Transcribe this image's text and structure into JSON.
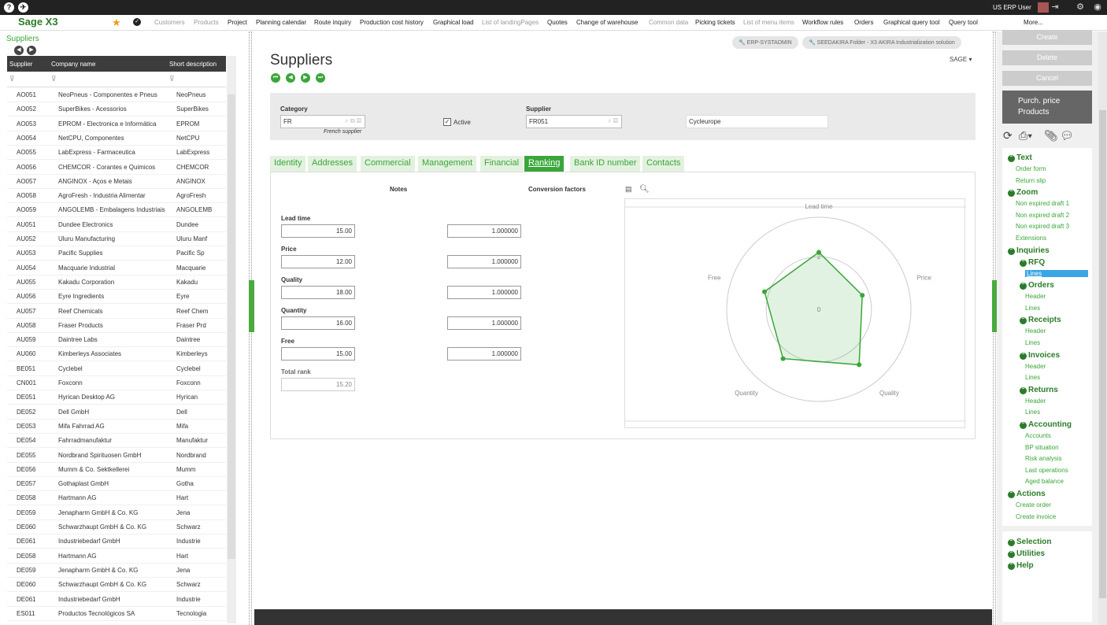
{
  "topbar": {
    "user": "US ERP User"
  },
  "nav": {
    "logo": "Sage X3",
    "items": [
      {
        "label": "Customers",
        "enabled": false
      },
      {
        "label": "Products",
        "enabled": false
      },
      {
        "label": "Project",
        "enabled": true
      },
      {
        "label": "Planning calendar",
        "enabled": true
      },
      {
        "label": "Route inquiry",
        "enabled": true
      },
      {
        "label": "Production cost history",
        "enabled": true
      },
      {
        "label": "Graphical load",
        "enabled": true
      },
      {
        "label": "List of landingPages",
        "enabled": false
      },
      {
        "label": "Quotes",
        "enabled": true
      },
      {
        "label": "Change of warehouse",
        "enabled": true
      },
      {
        "label": "Common data",
        "enabled": false
      },
      {
        "label": "Picking tickets",
        "enabled": true
      },
      {
        "label": "List of menu items",
        "enabled": false
      },
      {
        "label": "Workflow rules",
        "enabled": true
      },
      {
        "label": "Orders",
        "enabled": true
      },
      {
        "label": "Graphical query tool",
        "enabled": true
      },
      {
        "label": "Query tool",
        "enabled": true
      },
      {
        "label": "More...",
        "enabled": true
      }
    ]
  },
  "left": {
    "link": "Suppliers",
    "columns": [
      "Supplier",
      "Company name",
      "Short description"
    ],
    "rows": [
      [
        "AO051",
        "NeoPneus - Componentes e Pneus",
        "NeoPneus"
      ],
      [
        "AO052",
        "SuperBikes - Acessorios",
        "SuperBikes"
      ],
      [
        "AO053",
        "EPROM - Electronica e Informática",
        "EPROM"
      ],
      [
        "AO054",
        "NetCPU, Componentes",
        "NetCPU"
      ],
      [
        "AO055",
        "LabExpress - Farmaceutica",
        "LabExpress"
      ],
      [
        "AO056",
        "CHEMCOR - Corantes e Quimicos",
        "CHEMCOR"
      ],
      [
        "AO057",
        "ANGINOX - Aços e Metais",
        "ANGINOX"
      ],
      [
        "AO058",
        "AgroFresh - Industria Alimentar",
        "AgroFresh"
      ],
      [
        "AO059",
        "ANGOLEMB - Embalagens Industriais",
        "ANGOLEMB"
      ],
      [
        "AU051",
        "Dundee Electronics",
        "Dundee"
      ],
      [
        "AU052",
        "Uluru Manufacturing",
        "Uluru Manf"
      ],
      [
        "AU053",
        "Pacific Supplies",
        "Pacific Sp"
      ],
      [
        "AU054",
        "Macquarie Industrial",
        "Macquarie"
      ],
      [
        "AU055",
        "Kakadu Corporation",
        "Kakadu"
      ],
      [
        "AU056",
        "Eyre Ingredients",
        "Eyre"
      ],
      [
        "AU057",
        "Reef Chemicals",
        "Reef Chem"
      ],
      [
        "AU058",
        "Fraser Products",
        "Fraser Prd"
      ],
      [
        "AU059",
        "Daintree Labs",
        "Daintree"
      ],
      [
        "AU060",
        "Kimberleys Associates",
        "Kimberleys"
      ],
      [
        "BE051",
        "Cyclebel",
        "Cyclebel"
      ],
      [
        "CN001",
        "Foxconn",
        "Foxconn"
      ],
      [
        "DE051",
        "Hyrican Desktop AG",
        "Hyrican"
      ],
      [
        "DE052",
        "Dell GmbH",
        "Dell"
      ],
      [
        "DE053",
        "Mifa Fahrrad AG",
        "Mifa"
      ],
      [
        "DE054",
        "Fahrradmanufaktur",
        "Manufaktur"
      ],
      [
        "DE055",
        "Nordbrand Spirituosen GmbH",
        "Nordbrand"
      ],
      [
        "DE056",
        "Mumm & Co. Sektkellerei",
        "Mumm"
      ],
      [
        "DE057",
        "Gothaplast GmbH",
        "Gotha"
      ],
      [
        "DE058",
        "Hartmann AG",
        "Hart"
      ],
      [
        "DE059",
        "Jenapharm GmbH & Co. KG",
        "Jena"
      ],
      [
        "DE060",
        "Schwarzhaupt GmbH & Co. KG",
        "Schwarz"
      ],
      [
        "DE061",
        "Industriebedarf GmbH",
        "Industrie"
      ],
      [
        "DE058",
        "Hartmann AG",
        "Hart"
      ],
      [
        "DE059",
        "Jenapharm GmbH & Co. KG",
        "Jena"
      ],
      [
        "DE060",
        "Schwarzhaupt GmbH & Co. KG",
        "Schwarz"
      ],
      [
        "DE061",
        "Industriebedarf GmbH",
        "Industrie"
      ],
      [
        "ES011",
        "Productos Tecnológicos SA",
        "Tecnologia"
      ]
    ]
  },
  "main": {
    "crumb1": "ERP-SYSTADMIN",
    "crumb2": "SEEDAKIRA Folder - X3 AKIRA Industrialization solution",
    "title": "Suppliers",
    "sage": "SAGE",
    "category_label": "Category",
    "category_value": "FR",
    "category_desc": "French supplier",
    "active_label": "Active",
    "supplier_label": "Supplier",
    "supplier_value": "FR051",
    "supplier_name": "Cycleurope",
    "tabs": [
      "Identity",
      "Addresses",
      "Commercial",
      "Management",
      "Financial",
      "Ranking",
      "Bank ID number",
      "Contacts"
    ],
    "notes_label": "Notes",
    "conv_label": "Conversion factors",
    "ranking": [
      {
        "label": "Lead time",
        "note": "15.00",
        "factor": "1.000000"
      },
      {
        "label": "Price",
        "note": "12.00",
        "factor": "1.000000"
      },
      {
        "label": "Quality",
        "note": "18.00",
        "factor": "1.000000"
      },
      {
        "label": "Quantity",
        "note": "16.00",
        "factor": "1.000000"
      },
      {
        "label": "Free",
        "note": "15.00",
        "factor": "1.000000"
      }
    ],
    "total_label": "Total rank",
    "total_value": "15.20"
  },
  "chart_data": {
    "type": "radar",
    "axes": [
      "Lead time",
      "Price",
      "Quality",
      "Quantity",
      "Free"
    ],
    "values": [
      15,
      12,
      18,
      16,
      15
    ],
    "ticks": [
      "0",
      "2"
    ],
    "color": "#3aa63a"
  },
  "right": {
    "buttons": [
      "Create",
      "Delete",
      "Cancel"
    ],
    "purch": "Purch. price Products",
    "menu": [
      {
        "h": "Text",
        "items": [
          "Order form",
          "Return slip"
        ]
      },
      {
        "h": "Zoom",
        "items": [
          "Non expired draft 1",
          "Non expired draft 2",
          "Non expired draft 3",
          "Extensions"
        ]
      },
      {
        "h": "Inquiries",
        "items": []
      },
      {
        "h": "RFQ",
        "sub": true,
        "items": [
          "Lines"
        ]
      },
      {
        "h": "Orders",
        "sub": true,
        "items": [
          "Header",
          "Lines"
        ]
      },
      {
        "h": "Receipts",
        "sub": true,
        "items": [
          "Header",
          "Lines"
        ]
      },
      {
        "h": "Invoices",
        "sub": true,
        "items": [
          "Header",
          "Lines"
        ]
      },
      {
        "h": "Returns",
        "sub": true,
        "items": [
          "Header",
          "Lines"
        ]
      },
      {
        "h": "Accounting",
        "sub": true,
        "items": [
          "Accounts",
          "BP situation",
          "Risk analysis",
          "Last operations",
          "Aged balance"
        ]
      },
      {
        "h": "Actions",
        "items": [
          "Create order",
          "Create invoice"
        ]
      }
    ],
    "menu2": [
      "Selection",
      "Utilities",
      "Help"
    ]
  }
}
